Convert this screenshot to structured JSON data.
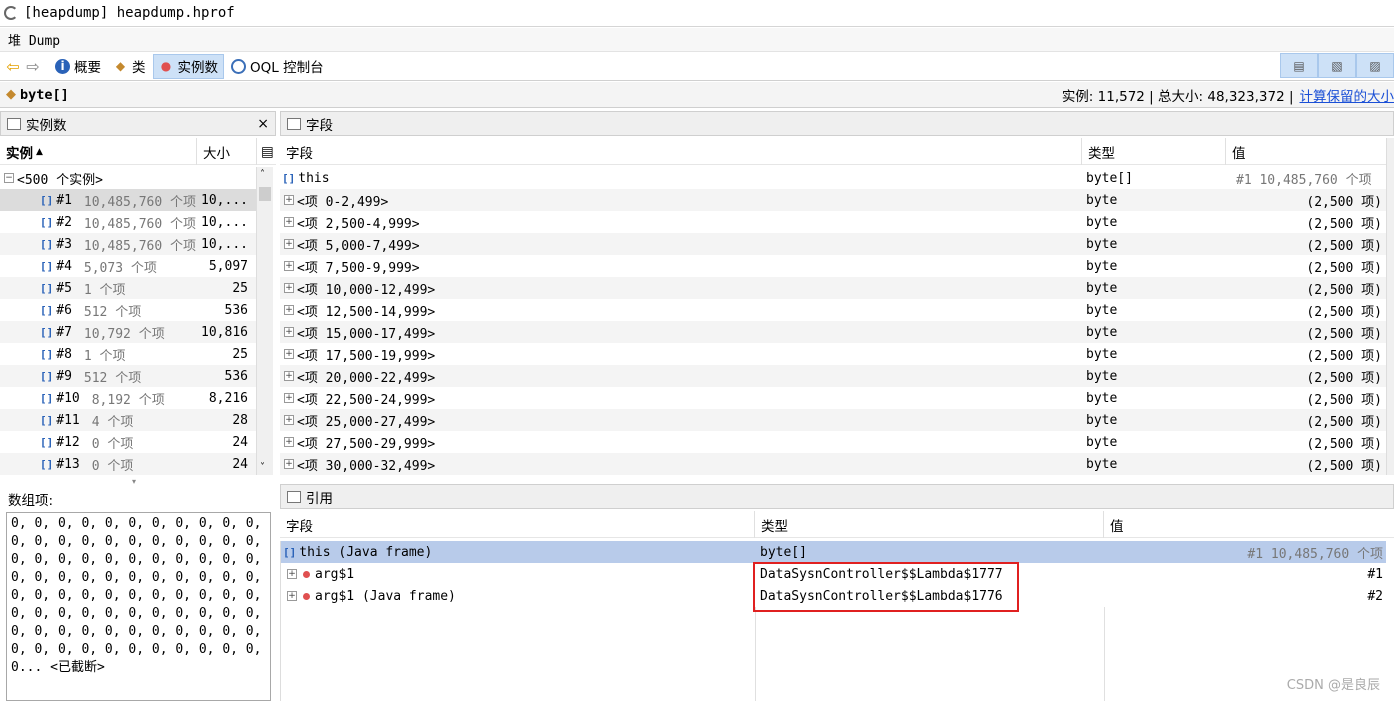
{
  "window": {
    "title": "[heapdump] heapdump.hprof"
  },
  "subtabs": {
    "label": "堆 Dump"
  },
  "toolbar": {
    "items": [
      {
        "label": "概要",
        "icon": "info-icon",
        "active": false
      },
      {
        "label": "类",
        "icon": "class-icon",
        "active": false
      },
      {
        "label": "实例数",
        "icon": "instance-icon",
        "active": true
      },
      {
        "label": "OQL 控制台",
        "icon": "oql-icon",
        "active": false
      }
    ]
  },
  "classbar": {
    "class_name": "byte[]",
    "stats": "实例: 11,572 | 总大小: 48,323,372 |",
    "retained_link": "计算保留的大小"
  },
  "instances_panel": {
    "title": "实例数",
    "columns": [
      "实例",
      "大小"
    ],
    "group_label": "<500 个实例>",
    "rows": [
      {
        "id": "#1",
        "detail": "10,485,760 个项",
        "size": "10,..."
      },
      {
        "id": "#2",
        "detail": "10,485,760 个项",
        "size": "10,..."
      },
      {
        "id": "#3",
        "detail": "10,485,760 个项",
        "size": "10,..."
      },
      {
        "id": "#4",
        "detail": "5,073 个项",
        "size": "5,097"
      },
      {
        "id": "#5",
        "detail": "1 个项",
        "size": "25"
      },
      {
        "id": "#6",
        "detail": "512 个项",
        "size": "536"
      },
      {
        "id": "#7",
        "detail": "10,792 个项",
        "size": "10,816"
      },
      {
        "id": "#8",
        "detail": "1 个项",
        "size": "25"
      },
      {
        "id": "#9",
        "detail": "512 个项",
        "size": "536"
      },
      {
        "id": "#10",
        "detail": "8,192 个项",
        "size": "8,216"
      },
      {
        "id": "#11",
        "detail": "4 个项",
        "size": "28"
      },
      {
        "id": "#12",
        "detail": "0 个项",
        "size": "24"
      },
      {
        "id": "#13",
        "detail": "0 个项",
        "size": "24"
      }
    ]
  },
  "array_panel": {
    "label": "数组项:",
    "content": "0, 0, 0, 0, 0, 0, 0, 0, 0, 0, 0, 0, 0, 0, 0, 0, 0, 0, 0, 0, 0, 0, 0, 0, 0, 0, 0, 0, 0, 0, 0, 0, 0, 0, 0, 0, 0, 0, 0, 0, 0, 0, 0, 0, 0, 0, 0, 0, 0, 0, 0, 0, 0, 0, 0, 0, 0, 0, 0, 0, 0, 0, 0, 0, 0, 0, 0, 0, 0, 0, 0, 0, 0, 0, 0, 0, 0, 0, 0, 0, 0, 0, 0, 0, 0, 0, 0, 0, 0... <已截断>"
  },
  "fields_panel": {
    "title": "字段",
    "columns": [
      "字段",
      "类型",
      "值"
    ],
    "this_row": {
      "field": "this",
      "type": "byte[]",
      "value": "#1  10,485,760 个项"
    },
    "rows": [
      {
        "field": "<项 0-2,499>",
        "type": "byte",
        "value": "(2,500 项)"
      },
      {
        "field": "<项 2,500-4,999>",
        "type": "byte",
        "value": "(2,500 项)"
      },
      {
        "field": "<项 5,000-7,499>",
        "type": "byte",
        "value": "(2,500 项)"
      },
      {
        "field": "<项 7,500-9,999>",
        "type": "byte",
        "value": "(2,500 项)"
      },
      {
        "field": "<项 10,000-12,499>",
        "type": "byte",
        "value": "(2,500 项)"
      },
      {
        "field": "<项 12,500-14,999>",
        "type": "byte",
        "value": "(2,500 项)"
      },
      {
        "field": "<项 15,000-17,499>",
        "type": "byte",
        "value": "(2,500 项)"
      },
      {
        "field": "<项 17,500-19,999>",
        "type": "byte",
        "value": "(2,500 项)"
      },
      {
        "field": "<项 20,000-22,499>",
        "type": "byte",
        "value": "(2,500 项)"
      },
      {
        "field": "<项 22,500-24,999>",
        "type": "byte",
        "value": "(2,500 项)"
      },
      {
        "field": "<项 25,000-27,499>",
        "type": "byte",
        "value": "(2,500 项)"
      },
      {
        "field": "<项 27,500-29,999>",
        "type": "byte",
        "value": "(2,500 项)"
      },
      {
        "field": "<项 30,000-32,499>",
        "type": "byte",
        "value": "(2,500 项)"
      }
    ]
  },
  "refs_panel": {
    "title": "引用",
    "columns": [
      "字段",
      "类型",
      "值"
    ],
    "rows": [
      {
        "field": "this (Java frame)",
        "type": "byte[]",
        "value": "#1  10,485,760 个项",
        "selected": true
      },
      {
        "field": "arg$1",
        "type": "DataSysnController$$Lambda$1777",
        "value": "#1",
        "selected": false
      },
      {
        "field": "arg$1 (Java frame)",
        "type": "DataSysnController$$Lambda$1776",
        "value": "#2",
        "selected": false
      }
    ]
  },
  "watermark": "CSDN @是良辰"
}
